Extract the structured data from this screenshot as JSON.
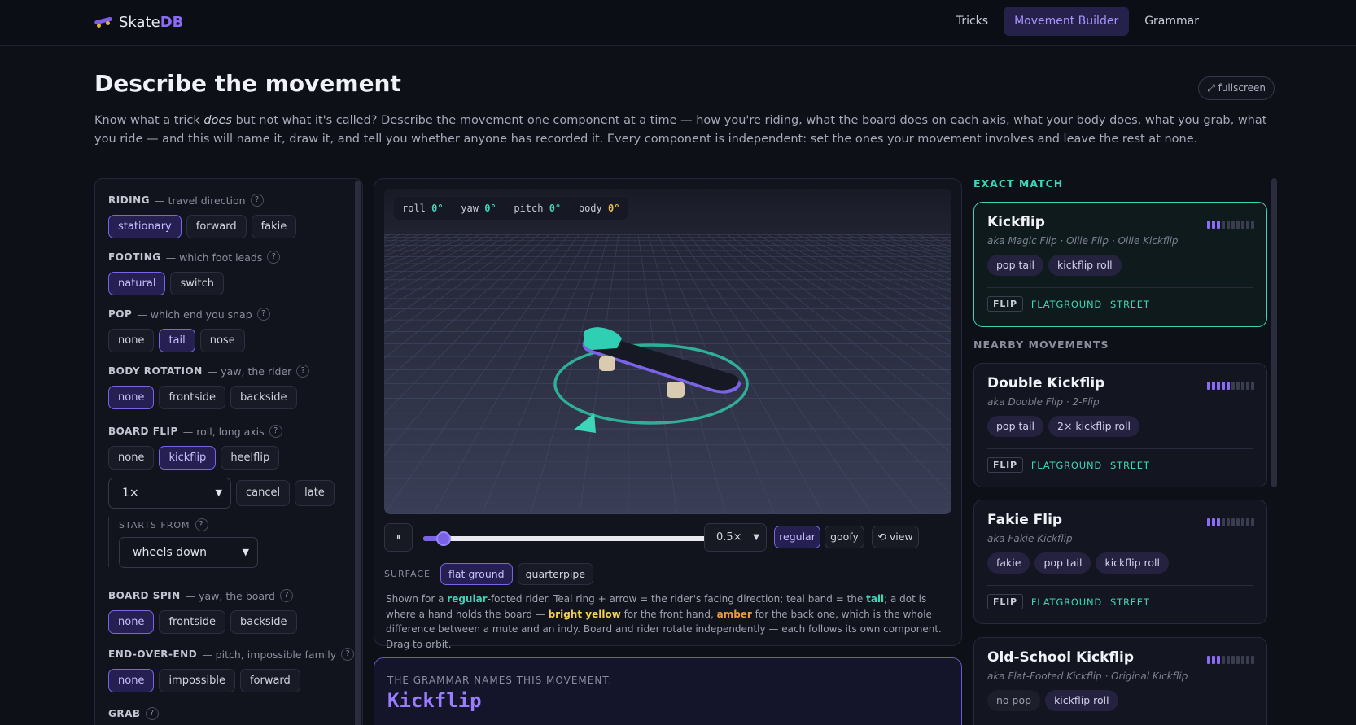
{
  "app": {
    "logo_plain": "Skate",
    "logo_accent": "DB"
  },
  "nav": {
    "items": [
      "Tricks",
      "Movement Builder",
      "Grammar"
    ],
    "active": "Movement Builder"
  },
  "header": {
    "title": "Describe the movement",
    "fullscreen": "⤢ fullscreen",
    "intro_1": "Know what a trick ",
    "intro_em": "does",
    "intro_2": " but not what it's called? Describe the movement one component at a time — how you're riding, what the board does on each axis, what your body does, what you grab, what you ride — and this will name it, draw it, and tell you whether anyone has recorded it. Every component is independent: set the ones your movement involves and leave the rest at none."
  },
  "builder": {
    "riding": {
      "name": "RIDING",
      "desc": "— travel direction",
      "options": [
        "stationary",
        "forward",
        "fakie"
      ],
      "selected": "stationary"
    },
    "footing": {
      "name": "FOOTING",
      "desc": "— which foot leads",
      "options": [
        "natural",
        "switch"
      ],
      "selected": "natural"
    },
    "pop": {
      "name": "POP",
      "desc": "— which end you snap",
      "options": [
        "none",
        "tail",
        "nose"
      ],
      "selected": "tail"
    },
    "body_rotation": {
      "name": "BODY ROTATION",
      "desc": "— yaw, the rider",
      "options": [
        "none",
        "frontside",
        "backside"
      ],
      "selected": "none"
    },
    "board_flip": {
      "name": "BOARD FLIP",
      "desc": "— roll, long axis",
      "options": [
        "none",
        "kickflip",
        "heelflip"
      ],
      "selected": "kickflip",
      "count": "1×",
      "extra_options": [
        "cancel",
        "late"
      ],
      "starts_from_label": "STARTS FROM",
      "starts_from": "wheels down"
    },
    "board_spin": {
      "name": "BOARD SPIN",
      "desc": "— yaw, the board",
      "options": [
        "none",
        "frontside",
        "backside"
      ],
      "selected": "none"
    },
    "end_over_end": {
      "name": "END-OVER-END",
      "desc": "— pitch, impossible family",
      "options": [
        "none",
        "impossible",
        "forward"
      ],
      "selected": "none"
    },
    "grab": {
      "name": "GRAB"
    },
    "help_glyph": "?"
  },
  "viewer": {
    "readout": {
      "roll_label": "roll",
      "roll": "0°",
      "yaw_label": "yaw",
      "yaw": "0°",
      "pitch_label": "pitch",
      "pitch": "0°",
      "body_label": "body",
      "body": "0°"
    },
    "pause_glyph": "⏸",
    "progress": 0.07,
    "speed": "0.5×",
    "stance_options": [
      "regular",
      "goofy"
    ],
    "stance_selected": "regular",
    "view_button": "⟲ view",
    "surface_label": "SURFACE",
    "surface_options": [
      "flat ground",
      "quarterpipe"
    ],
    "surface_selected": "flat ground",
    "caption": {
      "p1": "Shown for a ",
      "regular": "regular",
      "p2": "-footed rider. Teal ring + arrow = the rider's facing direction; teal band = the ",
      "tail": "tail",
      "p3": "; a dot is where a hand holds the board — ",
      "bright_yellow": "bright yellow",
      "p4": " for the front hand, ",
      "amber": "amber",
      "p5": " for the back one, which is the whole difference between a mute and an indy. Board and rider rotate independently — each follows its own component. Drag to orbit."
    },
    "colors": {
      "accent": "#7a63e6",
      "teal": "#3bd6b9",
      "grip": "#161824",
      "wheels": "#d8cbb0"
    }
  },
  "grammar": {
    "label": "THE GRAMMAR NAMES THIS MOVEMENT:",
    "name": "Kickflip"
  },
  "results": {
    "exact_label": "EXACT MATCH",
    "nearby_label": "NEARBY MOVEMENTS",
    "exact": {
      "name": "Kickflip",
      "aka": "aka Magic Flip · Ollie Flip · Ollie Kickflip",
      "tags": [
        "pop tail",
        "kickflip roll"
      ],
      "category": "FLIP",
      "keywords": [
        "FLATGROUND",
        "STREET"
      ],
      "difficulty": 3
    },
    "nearby": [
      {
        "name": "Double Kickflip",
        "aka": "aka Double Flip · 2-Flip",
        "tags": [
          "pop tail",
          "2× kickflip roll"
        ],
        "category": "FLIP",
        "keywords": [
          "FLATGROUND",
          "STREET"
        ],
        "difficulty": 5
      },
      {
        "name": "Fakie Flip",
        "aka": "aka Fakie Kickflip",
        "tags": [
          "fakie",
          "pop tail",
          "kickflip roll"
        ],
        "category": "FLIP",
        "keywords": [
          "FLATGROUND",
          "STREET"
        ],
        "difficulty": 3
      },
      {
        "name": "Old-School Kickflip",
        "aka": "aka Flat-Footed Kickflip · Original Kickflip",
        "tags": [
          "no pop",
          "kickflip roll"
        ],
        "difficulty": 3
      }
    ]
  }
}
